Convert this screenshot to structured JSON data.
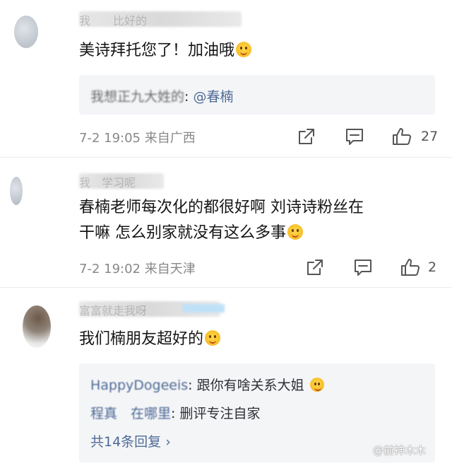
{
  "comments": [
    {
      "username": "我    比好的",
      "text": "美诗拜托您了！加油哦",
      "emoji": "face-emoji",
      "reply_preview": {
        "author": "我想正九大姓的",
        "text": "@春楠"
      },
      "time": "7-2 19:05",
      "location": "来自广西",
      "likes": "27"
    },
    {
      "username": "我  学习呢",
      "text_line1": "春楠老师每次化的都很好啊 刘诗诗粉丝在",
      "text_line2": "干嘛 怎么别家就没有这么多事",
      "emoji": "hug-emoji",
      "time": "7-2 19:02",
      "location": "来自天津",
      "likes": "2"
    },
    {
      "username": "富富就走我呀",
      "text": "我们楠朋友超好的",
      "emoji": "face-emoji",
      "replies": [
        {
          "author": "HappyDogeeis",
          "text": "跟你有啥关系大姐"
        },
        {
          "author": "程真  在哪里",
          "text": "删评专注自家"
        }
      ],
      "more_replies": "共14条回复 ›"
    }
  ],
  "watermark": "@前神木木",
  "colors": {
    "link": "#4e6a96",
    "meta": "#888888",
    "quote_bg": "#f4f5f7"
  }
}
